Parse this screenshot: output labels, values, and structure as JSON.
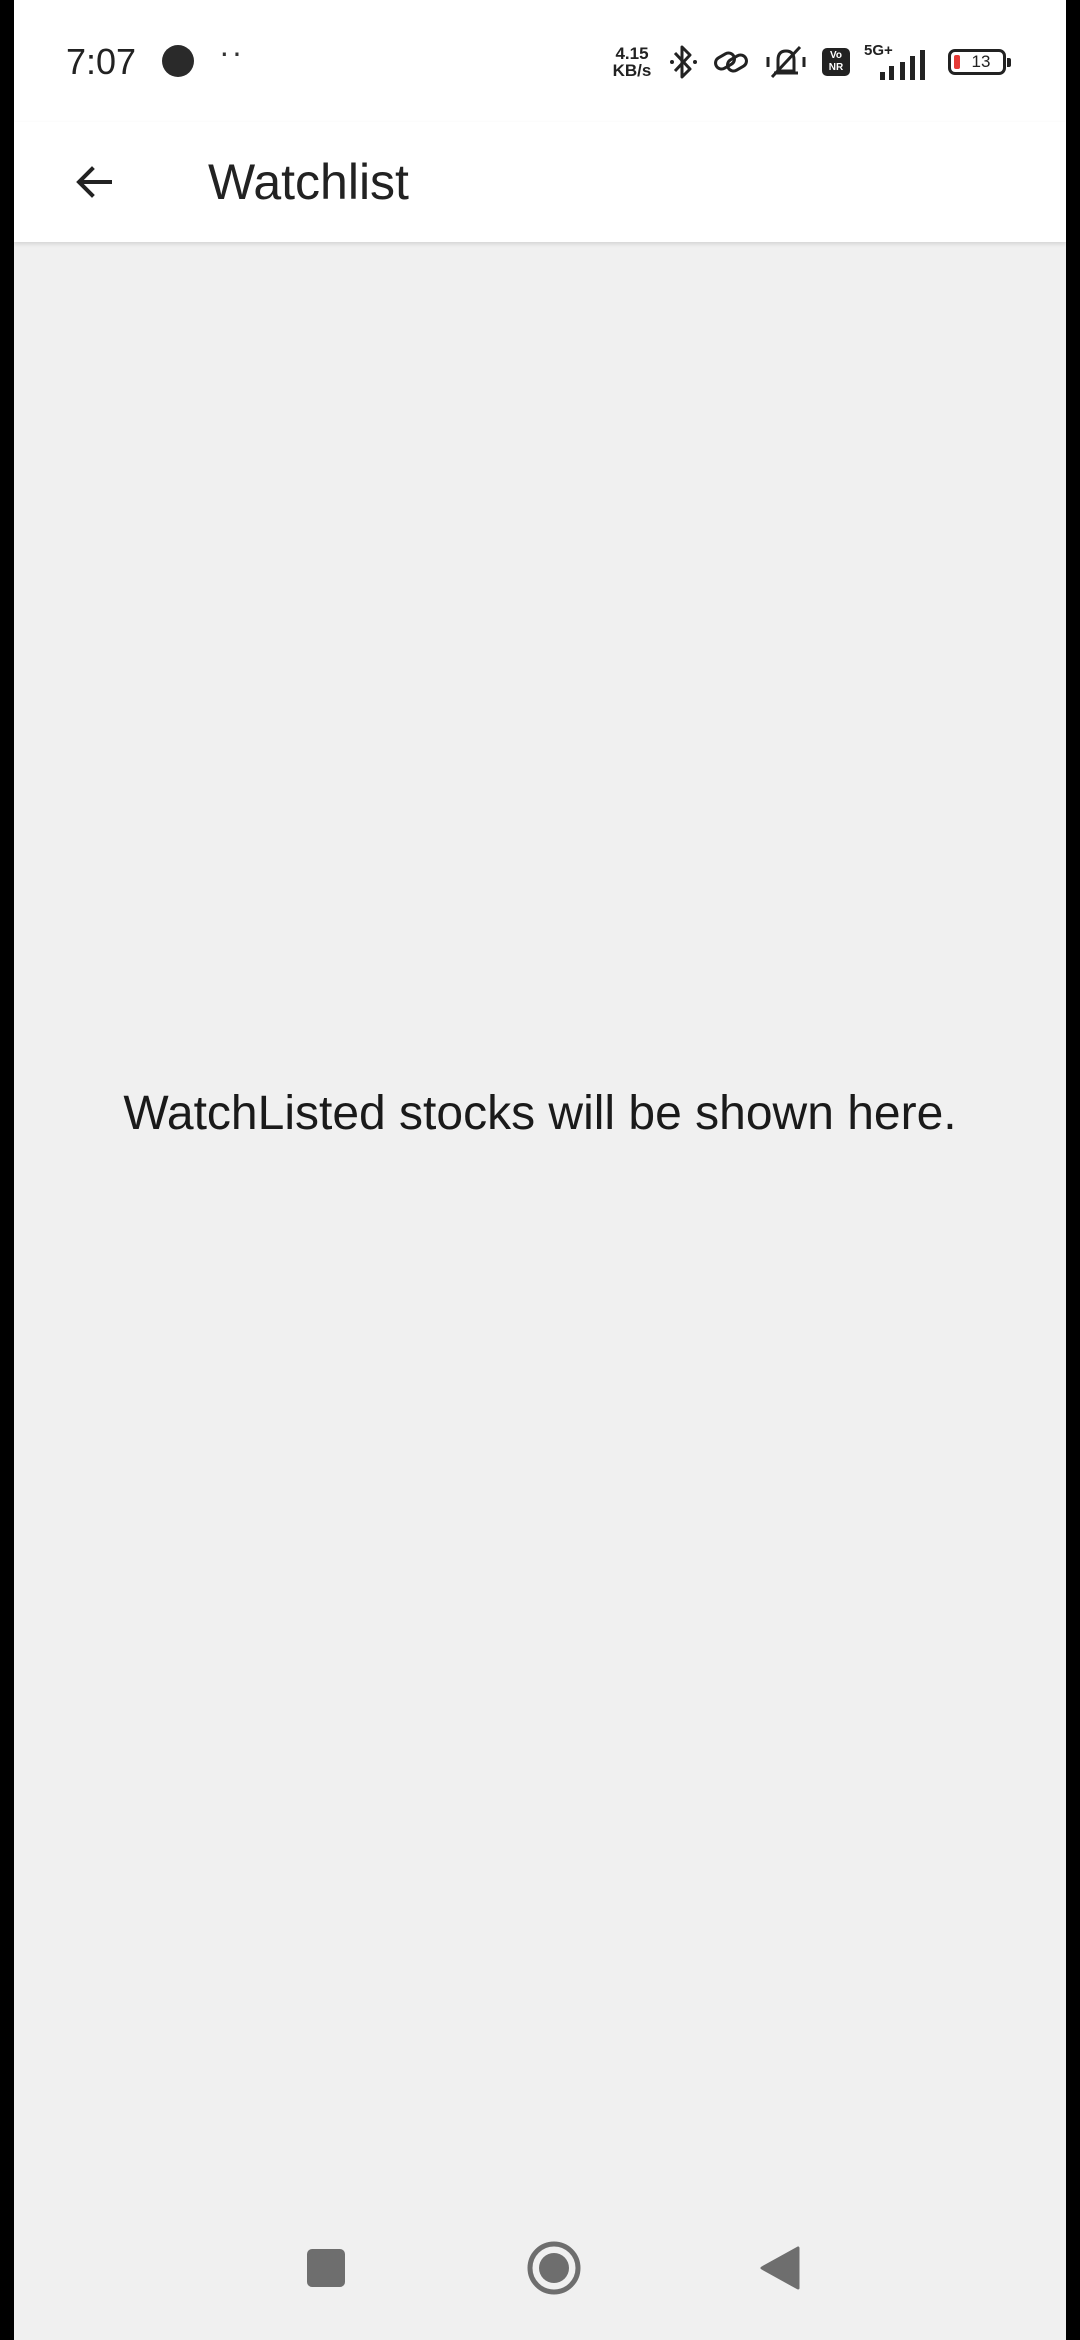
{
  "status_bar": {
    "time": "7:07",
    "dots": "··",
    "net_speed_value": "4.15",
    "net_speed_unit": "KB/s",
    "volte_top": "Vo",
    "volte_bottom": "NR",
    "network_type": "5G+",
    "battery_level": "13",
    "icons": [
      "app-notification-icon",
      "bluetooth-icon",
      "link-icon",
      "vibrate-mute-icon",
      "volte-icon",
      "signal-icon",
      "battery-icon"
    ]
  },
  "app_bar": {
    "title": "Watchlist",
    "back_icon": "arrow-left-icon"
  },
  "main": {
    "empty_message": "WatchListed stocks will be shown here."
  },
  "nav_bar": {
    "icons": [
      "recents-square-icon",
      "home-circle-icon",
      "back-triangle-icon"
    ]
  },
  "colors": {
    "background": "#f0f0f0",
    "app_bar": "#ffffff",
    "text": "#222222",
    "battery_low": "#e53935"
  }
}
